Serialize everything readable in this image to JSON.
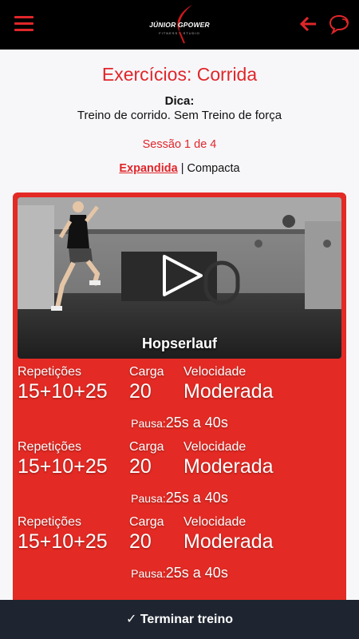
{
  "header": {
    "logo_text": "JÚNIOR GPOWER",
    "logo_sub": "FITNESS · STUDIO",
    "menu_icon": "hamburger-menu-icon",
    "back_icon": "arrow-left-icon",
    "chat_icon": "chat-bubbles-icon"
  },
  "page": {
    "title": "Exercícios: Corrida",
    "tip_label": "Dica:",
    "tip_text": "Treino de corrido. Sem Treino de força",
    "session": "Sessão 1 de 4",
    "view_expanded": "Expandida",
    "view_separator": " | ",
    "view_compact": "Compacta"
  },
  "exercise": {
    "name": "Hopserlauf",
    "sets": [
      {
        "reps_label": "Repetições",
        "reps": "15+10+25",
        "load_label": "Carga",
        "load": "20",
        "speed_label": "Velocidade",
        "speed": "Moderada",
        "rest_label": "Pausa:",
        "rest": "25s a 40s"
      },
      {
        "reps_label": "Repetições",
        "reps": "15+10+25",
        "load_label": "Carga",
        "load": "20",
        "speed_label": "Velocidade",
        "speed": "Moderada",
        "rest_label": "Pausa:",
        "rest": "25s a 40s"
      },
      {
        "reps_label": "Repetições",
        "reps": "15+10+25",
        "load_label": "Carga",
        "load": "20",
        "speed_label": "Velocidade",
        "speed": "Moderada",
        "rest_label": "Pausa:",
        "rest": "25s a 40s"
      }
    ]
  },
  "footer": {
    "finish_label": "✓ Terminar treino"
  },
  "colors": {
    "accent": "#e0262a",
    "card": "#e32a24",
    "footer": "#1e2530"
  }
}
